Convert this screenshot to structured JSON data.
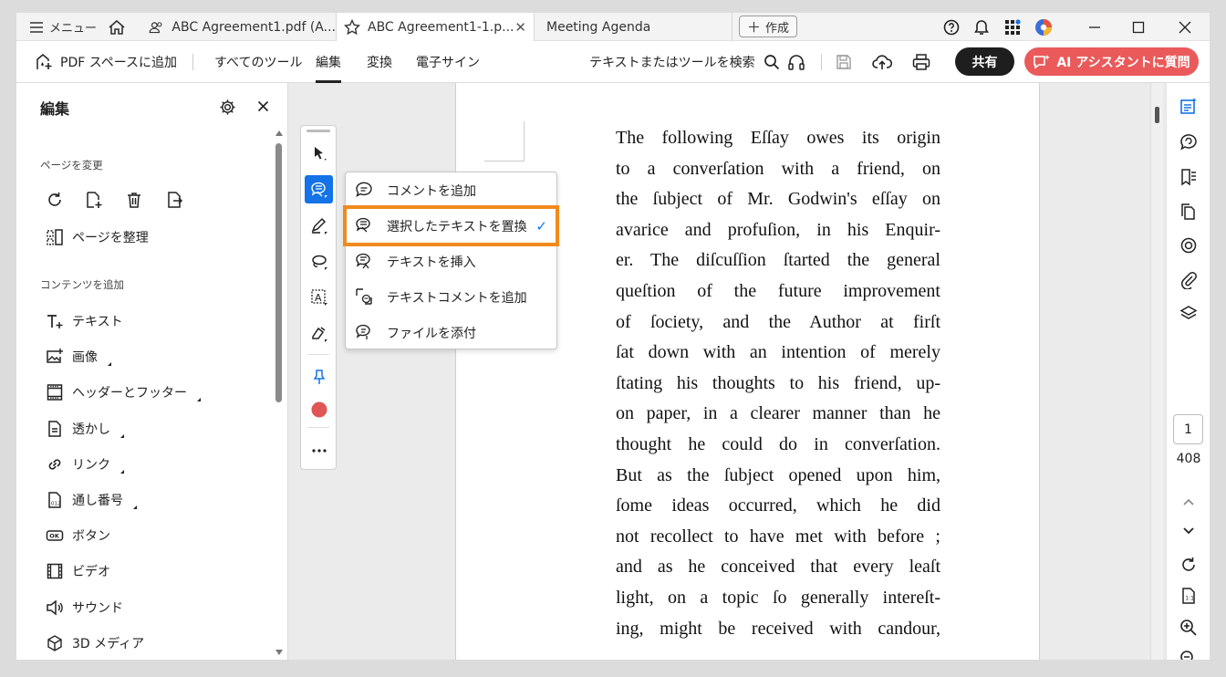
{
  "tabs": {
    "menu_label": "メニュー",
    "items": [
      {
        "label": "ABC Agreement1.pdf (A..."
      },
      {
        "label": "ABC Agreement1-1.p..."
      },
      {
        "label": "Meeting Agenda"
      }
    ],
    "create_label": "作成"
  },
  "toolbar": {
    "add_space": "PDF スペースに追加",
    "all_tools": "すべてのツール",
    "edit": "編集",
    "convert": "変換",
    "esign": "電子サイン",
    "search_placeholder": "テキストまたはツールを検索",
    "share": "共有",
    "ai_assistant": "AI アシスタントに質問"
  },
  "left_panel": {
    "title": "編集",
    "section_page": "ページを変更",
    "organize_pages": "ページを整理",
    "section_content": "コンテンツを追加",
    "items": [
      {
        "label": "テキスト",
        "icon": "text-add-icon"
      },
      {
        "label": "画像",
        "icon": "image-icon"
      },
      {
        "label": "ヘッダーとフッター",
        "icon": "header-footer-icon"
      },
      {
        "label": "透かし",
        "icon": "watermark-icon"
      },
      {
        "label": "リンク",
        "icon": "link-icon"
      },
      {
        "label": "通し番号",
        "icon": "bates-number-icon"
      },
      {
        "label": "ボタン",
        "icon": "button-icon"
      },
      {
        "label": "ビデオ",
        "icon": "video-icon"
      },
      {
        "label": "サウンド",
        "icon": "sound-icon"
      },
      {
        "label": "3D メディア",
        "icon": "3d-media-icon"
      }
    ]
  },
  "dropdown": {
    "items": [
      {
        "label": "コメントを追加"
      },
      {
        "label": "選択したテキストを置換",
        "checked": true
      },
      {
        "label": "テキストを挿入"
      },
      {
        "label": "テキストコメントを追加"
      },
      {
        "label": "ファイルを添付"
      }
    ]
  },
  "document": {
    "lines": [
      "The following Eſſay owes its origin",
      "to a converſation with a friend, on",
      "the ſubject of Mr. Godwin's eſſay on",
      "avarice and profuſion, in his Enquir-",
      "er. The diſcuſſion ſtarted the general",
      "queſtion of the future improvement",
      "of ſociety, and the Author at firſt",
      "ſat down with an intention of merely",
      "ſtating his thoughts to his friend, up-",
      "on paper, in a clearer manner than he",
      "thought he could do in converſation.",
      "But as the ſubject opened upon him,",
      "ſome ideas occurred, which he did",
      "not recollect to have met with before ;",
      "and as he conceived that every leaſt",
      "light, on a topic ſo generally intereſt-",
      "ing, might be received with candour,"
    ]
  },
  "navigation": {
    "current_page": "1",
    "total_pages": "408"
  },
  "colors": {
    "accent_blue": "#1473e6",
    "highlight_orange": "#f08a1c",
    "ai_button": "#ea5a5a",
    "share_button": "#1e1e1e",
    "stamp_red": "#e05656"
  }
}
